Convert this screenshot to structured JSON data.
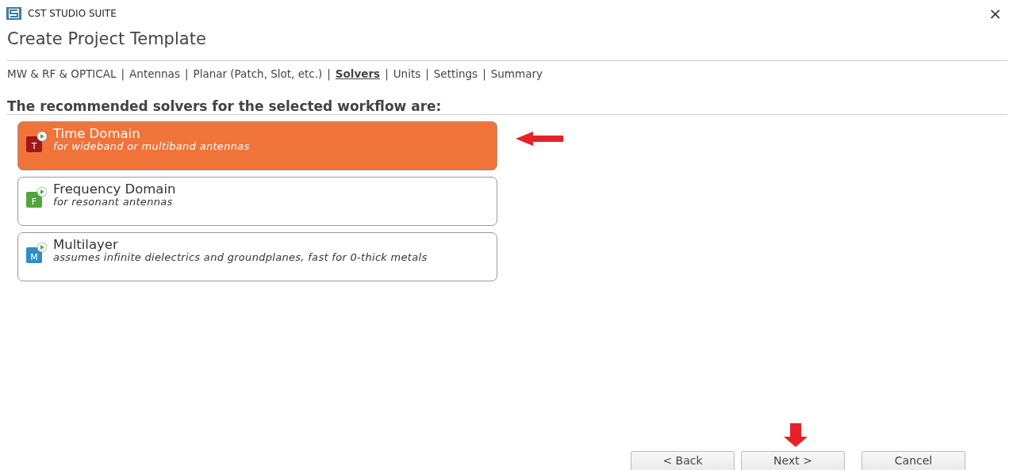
{
  "window": {
    "title": "CST STUDIO SUITE",
    "close": "×"
  },
  "page_title": "Create Project Template",
  "breadcrumb": [
    {
      "kind": "step",
      "label": "MW & RF & OPTICAL",
      "selected": false
    },
    {
      "kind": "separator",
      "label": "|"
    },
    {
      "kind": "step",
      "label": "Antennas",
      "selected": false
    },
    {
      "kind": "separator",
      "label": "|"
    },
    {
      "kind": "step",
      "label": "Planar (Patch, Slot, etc.)",
      "selected": false
    },
    {
      "kind": "separator",
      "label": "|"
    },
    {
      "kind": "step",
      "label": "Solvers",
      "selected": true
    },
    {
      "kind": "separator",
      "label": "|"
    },
    {
      "kind": "step",
      "label": "Units",
      "selected": false
    },
    {
      "kind": "separator",
      "label": "|"
    },
    {
      "kind": "step",
      "label": "Settings",
      "selected": false
    },
    {
      "kind": "separator",
      "label": "|"
    },
    {
      "kind": "step",
      "label": "Summary",
      "selected": false
    }
  ],
  "section_heading": "The recommended solvers for the selected workflow are:",
  "solvers": [
    {
      "name": "Time Domain",
      "description": "for wideband or multiband antennas",
      "icon_letter": "T",
      "color": "#a01818",
      "selected": true
    },
    {
      "name": "Frequency Domain",
      "description": "for resonant antennas",
      "icon_letter": "F",
      "color": "#4ea63c",
      "selected": false
    },
    {
      "name": "Multilayer",
      "description": "assumes infinite dielectrics and groundplanes, fast for 0-thick metals",
      "icon_letter": "M",
      "color": "#2f8fc4",
      "selected": false
    }
  ],
  "buttons": [
    "< Back",
    "Next >",
    "Cancel"
  ]
}
